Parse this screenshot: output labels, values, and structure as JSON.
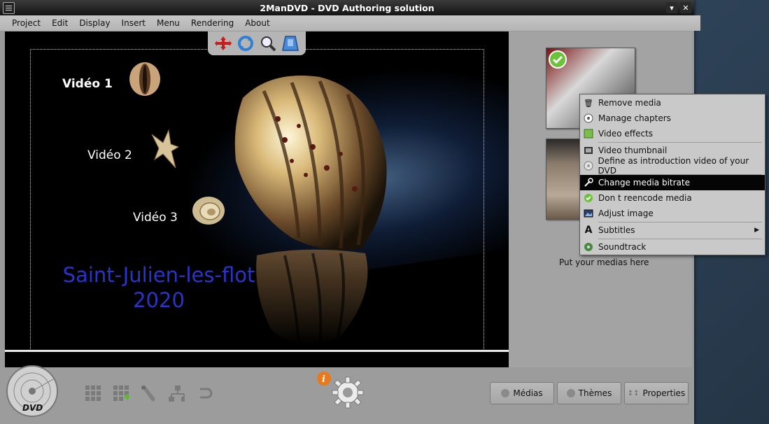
{
  "window": {
    "title": "2ManDVD - DVD Authoring solution",
    "controls": [
      "minimize",
      "close"
    ]
  },
  "menubar": [
    "Project",
    "Edit",
    "Display",
    "Insert",
    "Menu",
    "Rendering",
    "About"
  ],
  "preview": {
    "video_labels": [
      "Vidéo 1",
      "Vidéo 2",
      "Vidéo 3"
    ],
    "title_line1": "Saint-Julien-les-flot",
    "title_line2": "2020",
    "title_color": "#2b34c9"
  },
  "toolbox_icons": [
    "move-icon",
    "refresh-icon",
    "zoom-icon",
    "select-icon"
  ],
  "media_panel": {
    "hint": "Put your medias here"
  },
  "context_menu": {
    "items": [
      {
        "label": "Remove media",
        "icon": "trash-icon"
      },
      {
        "label": "Manage chapters",
        "icon": "chapters-icon"
      },
      {
        "label": "Video effects",
        "icon": "effects-icon"
      },
      {
        "label": "Video thumbnail",
        "icon": "thumbnail-icon"
      },
      {
        "label": "Define as introduction video of your DVD",
        "icon": "disc-icon"
      },
      {
        "label": "Change media bitrate",
        "icon": "wrench-icon"
      },
      {
        "label": "Don t reencode media",
        "icon": "check-icon"
      },
      {
        "label": "Adjust image",
        "icon": "image-icon"
      },
      {
        "label": "Subtitles",
        "icon": "subtitle-icon"
      },
      {
        "label": "Soundtrack",
        "icon": "sound-icon"
      }
    ],
    "active_index": 5
  },
  "bottom": {
    "logo_text": "DVD",
    "tabs": [
      "Médias",
      "Thèmes",
      "Properties"
    ],
    "accent": "#e87a1e"
  }
}
